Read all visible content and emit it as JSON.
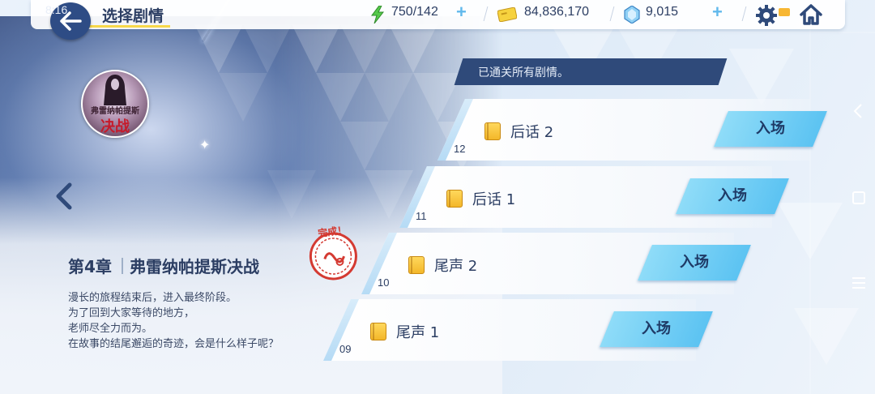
{
  "status": {
    "time": "8:16"
  },
  "header": {
    "title": "选择剧情",
    "stamina": "750/142",
    "credits": "84,836,170",
    "pyroxene": "9,015"
  },
  "banner": {
    "text": "已通关所有剧情。"
  },
  "chapter": {
    "badge_top": "弗雷纳帕提斯",
    "badge_main": "决战",
    "number": "第4章",
    "name": "弗雷纳帕提斯决战",
    "description": [
      "漫长的旅程结束后，进入最终阶段。",
      "为了回到大家等待的地方，",
      "老师尽全力而为。",
      "在故事的结尾邂逅的奇迹，会是什么样子呢？"
    ],
    "stamp_text": "完成！"
  },
  "episodes": [
    {
      "number": "12",
      "title": "后话 2",
      "button": "入场"
    },
    {
      "number": "11",
      "title": "后话 1",
      "button": "入场"
    },
    {
      "number": "10",
      "title": "尾声 2",
      "button": "入场"
    },
    {
      "number": "09",
      "title": "尾声 1",
      "button": "入场"
    }
  ],
  "colors": {
    "navy": "#2c3e63",
    "button_blue": "#5cc3f2",
    "banner": "#2f4a7a",
    "accent_yellow": "#f7d84a"
  },
  "icons": {
    "back": "back-arrow-icon",
    "stamina": "lightning-icon",
    "credits": "credit-card-icon",
    "pyroxene": "crystal-icon",
    "settings": "gear-icon",
    "home": "home-icon",
    "prev_chapter": "chevron-left-icon",
    "episode": "book-icon"
  }
}
